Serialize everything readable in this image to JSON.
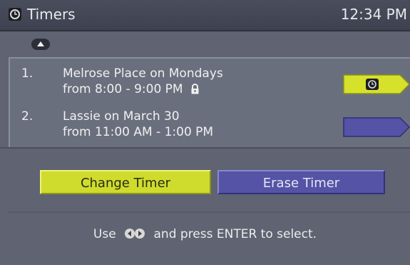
{
  "header": {
    "title": "Timers",
    "clock": "12:34 PM",
    "icon": "timer-clock-icon"
  },
  "timers": [
    {
      "number": "1.",
      "line1": "Melrose Place on Mondays",
      "line2": "from 8:00 - 9:00 PM",
      "locked": true,
      "selected": true,
      "tag_color": "#d6e12c"
    },
    {
      "number": "2.",
      "line1": "Lassie on March 30",
      "line2": "from 11:00 AM - 1:00 PM",
      "locked": false,
      "selected": false,
      "tag_color": "#5553a6"
    }
  ],
  "buttons": {
    "change": "Change Timer",
    "erase": "Erase Timer"
  },
  "hint": {
    "before": "Use",
    "after": "and press ENTER to select."
  },
  "colors": {
    "background": "#5f6372",
    "accent_yellow": "#cfdc2e",
    "accent_purple": "#5553a6"
  }
}
